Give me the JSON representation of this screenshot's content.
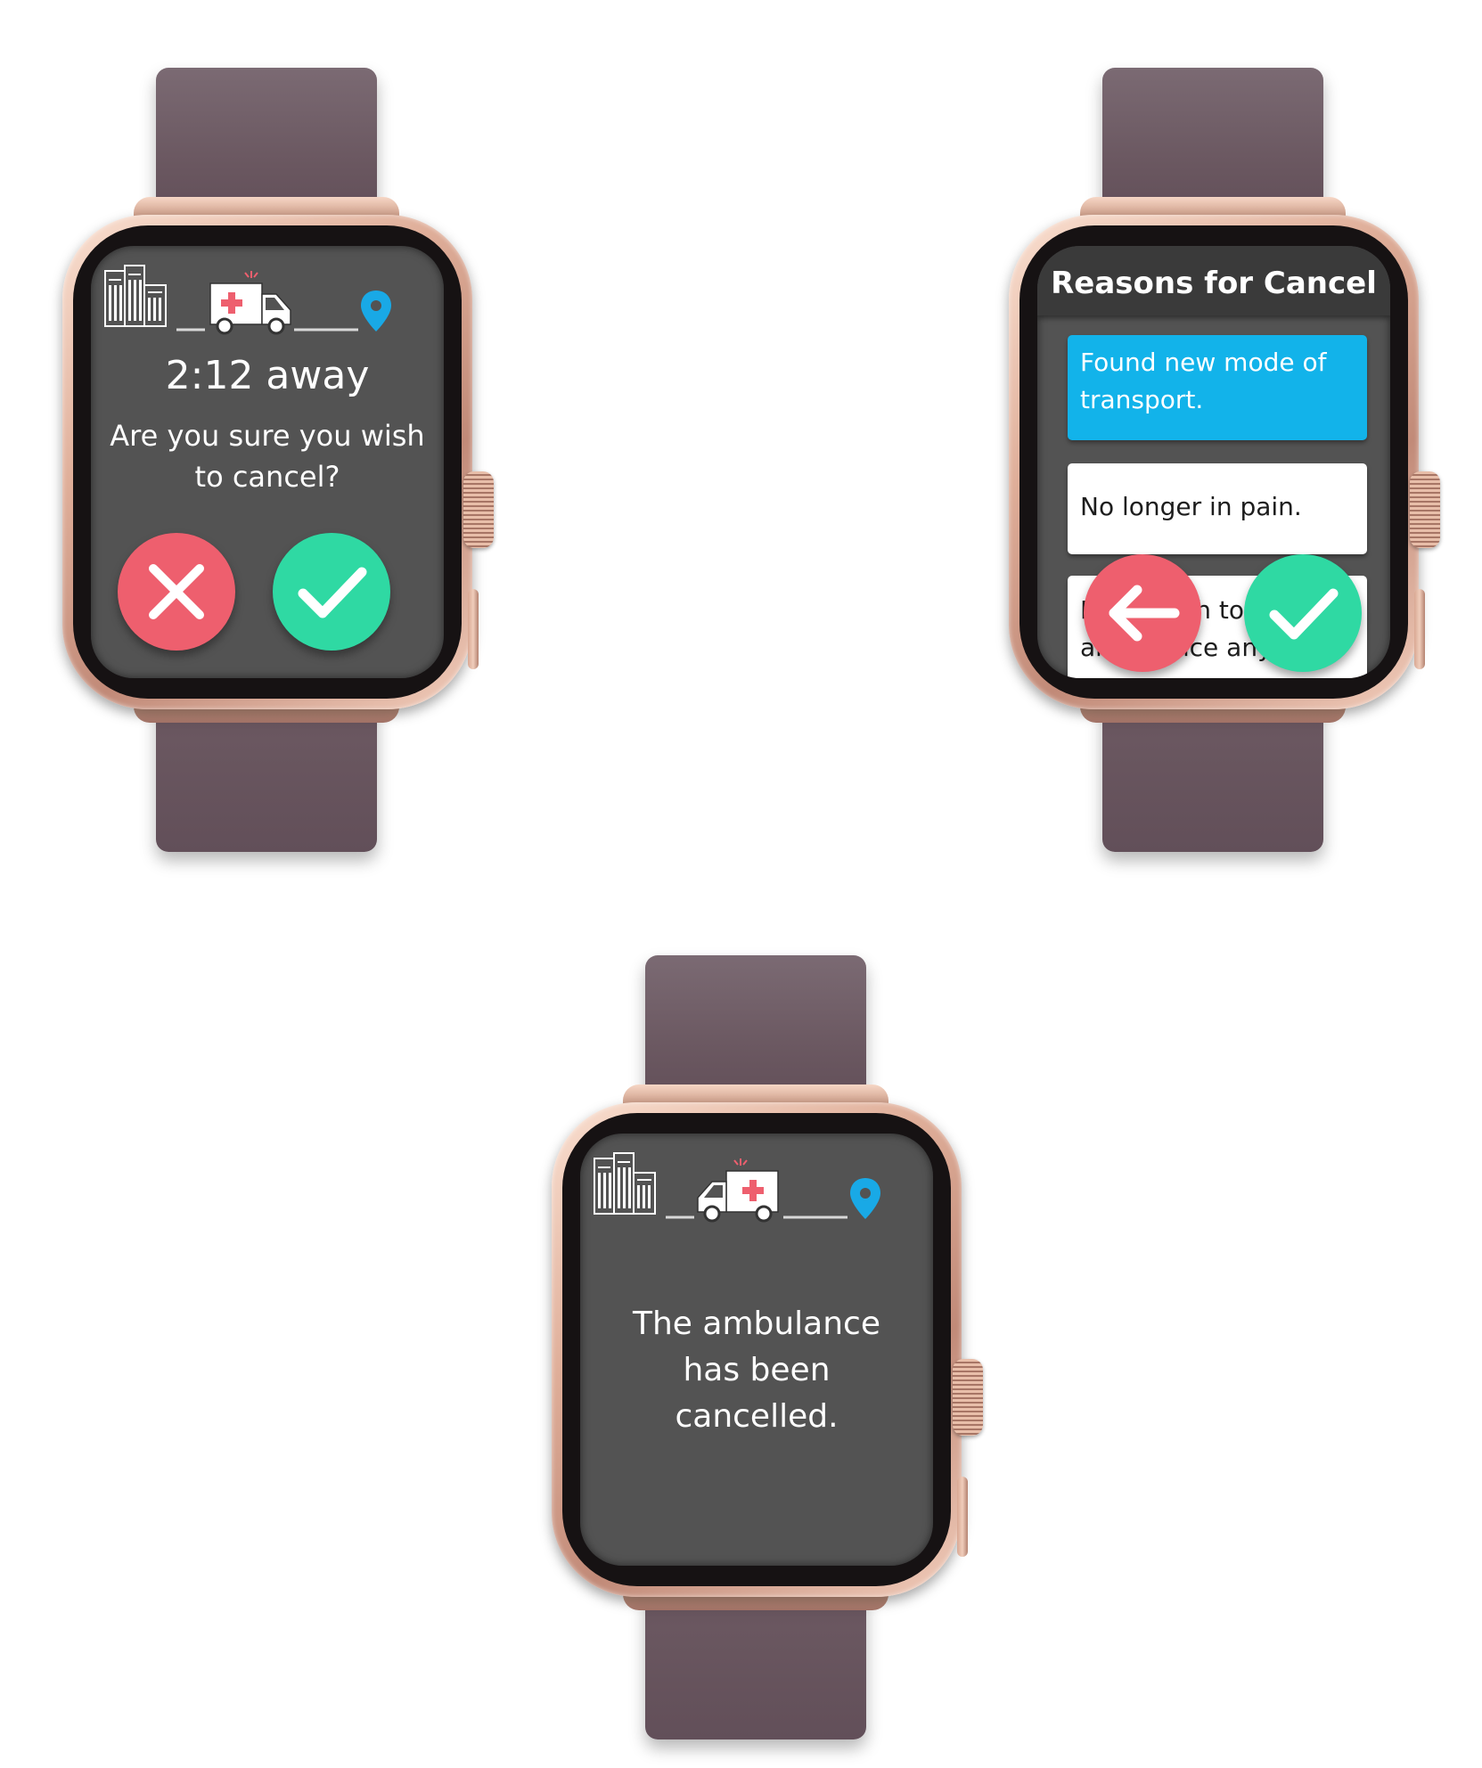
{
  "screens": [
    {
      "id": "confirm-cancel",
      "eta": "2:12 away",
      "question": "Are you sure you wish to cancel?",
      "cancel_icon": "x-icon",
      "confirm_icon": "check-icon"
    },
    {
      "id": "reasons",
      "title": "Reasons for Cancel",
      "reasons": [
        {
          "label": "Found new mode of transport.",
          "selected": true
        },
        {
          "label": "No longer in pain.",
          "selected": false
        },
        {
          "label": "Don't wish to take ambulance anymore.",
          "selected": false
        }
      ],
      "back_icon": "arrow-left-icon",
      "confirm_icon": "check-icon"
    },
    {
      "id": "cancelled",
      "message": "The ambulance has been cancelled."
    }
  ],
  "icons": {
    "origin": "buildings-icon",
    "vehicle": "ambulance-icon",
    "destination": "location-pin-icon"
  },
  "colors": {
    "screen_bg": "#535353",
    "header_bg": "#3a3a3a",
    "cancel_red": "#ee5f6e",
    "confirm_green": "#2fd9a3",
    "selected_blue": "#12b3ea",
    "pin_blue": "#19a9e6",
    "band": "#6a5760",
    "case_gold": "#dfae99"
  }
}
